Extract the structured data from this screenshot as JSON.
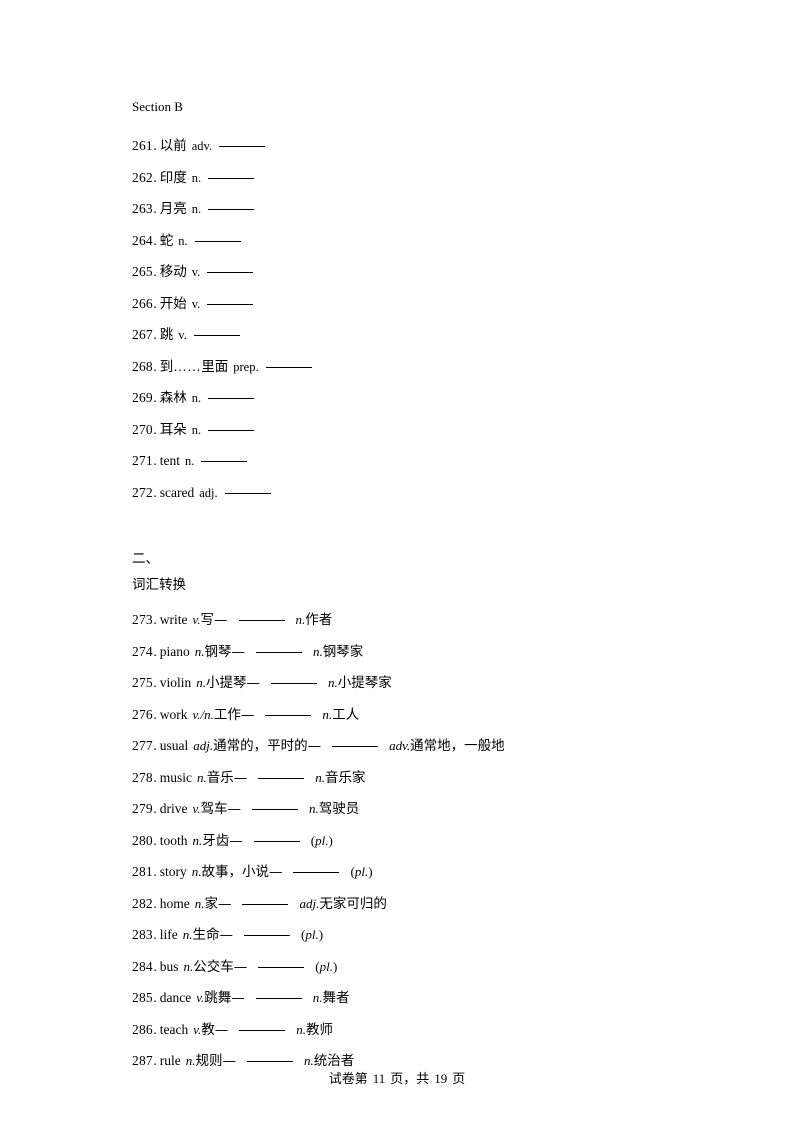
{
  "document": {
    "section_b_label": "Section B",
    "part_two_heading": "二、",
    "part_two_subheading": "词汇转换"
  },
  "vocab_items": [
    {
      "num": "261",
      "dot": ".",
      "term": "以前",
      "term_lang": "cn",
      "pos": "adv.",
      "pos_italic": false
    },
    {
      "num": "262",
      "dot": ".",
      "term": "印度",
      "term_lang": "cn",
      "pos": "n.",
      "pos_italic": false
    },
    {
      "num": "263",
      "dot": ".",
      "term": "月亮",
      "term_lang": "cn",
      "pos": "n.",
      "pos_italic": false
    },
    {
      "num": "264",
      "dot": ".",
      "term": "蛇",
      "term_lang": "cn",
      "pos": "n.",
      "pos_italic": false
    },
    {
      "num": "265",
      "dot": ".",
      "term": "移动",
      "term_lang": "cn",
      "pos": "v.",
      "pos_italic": false
    },
    {
      "num": "266",
      "dot": ".",
      "term": "开始",
      "term_lang": "cn",
      "pos": "v.",
      "pos_italic": false
    },
    {
      "num": "267",
      "dot": ".",
      "term": "跳",
      "term_lang": "cn",
      "pos": "v.",
      "pos_italic": false
    },
    {
      "num": "268",
      "dot": ".",
      "term": "到……里面",
      "term_lang": "cn",
      "pos": "prep.",
      "pos_italic": false
    },
    {
      "num": "269",
      "dot": ".",
      "term": "森林",
      "term_lang": "cn",
      "pos": "n.",
      "pos_italic": false
    },
    {
      "num": "270",
      "dot": ".",
      "term": "耳朵",
      "term_lang": "cn",
      "pos": "n.",
      "pos_italic": false
    },
    {
      "num": "271",
      "dot": ".",
      "term": "tent",
      "term_lang": "en",
      "pos": "n.",
      "pos_italic": false
    },
    {
      "num": "272",
      "dot": ".",
      "term": "scared",
      "term_lang": "en",
      "pos": "adj.",
      "pos_italic": false
    }
  ],
  "conversion_items": [
    {
      "num": "273",
      "dot": ".",
      "word": "write",
      "pos1": "v.",
      "gloss1": "写",
      "answer_pos": "n.",
      "answer_gloss": "作者"
    },
    {
      "num": "274",
      "dot": ".",
      "word": "piano",
      "pos1": "n.",
      "gloss1": "钢琴",
      "answer_pos": "n.",
      "answer_gloss": "钢琴家"
    },
    {
      "num": "275",
      "dot": ".",
      "word": "violin",
      "pos1": "n.",
      "gloss1": "小提琴",
      "answer_pos": "n.",
      "answer_gloss": "小提琴家"
    },
    {
      "num": "276",
      "dot": ".",
      "word": "work",
      "pos1": "v./n.",
      "gloss1": "工作",
      "answer_pos": "n.",
      "answer_gloss": "工人"
    },
    {
      "num": "277",
      "dot": ".",
      "word": "usual",
      "pos1": "adj.",
      "gloss1": "通常的，平时的",
      "answer_pos": "adv.",
      "answer_gloss": "通常地，一般地"
    },
    {
      "num": "278",
      "dot": ".",
      "word": "music",
      "pos1": "n.",
      "gloss1": "音乐",
      "answer_pos": "n.",
      "answer_gloss": "音乐家"
    },
    {
      "num": "279",
      "dot": ".",
      "word": "drive",
      "pos1": "v.",
      "gloss1": "驾车",
      "answer_pos": "n.",
      "answer_gloss": "驾驶员"
    },
    {
      "num": "280",
      "dot": ".",
      "word": "tooth",
      "pos1": "n.",
      "gloss1": "牙齿",
      "answer_pos": "",
      "answer_gloss": "",
      "plural": "pl."
    },
    {
      "num": "281",
      "dot": ".",
      "word": "story",
      "pos1": "n.",
      "gloss1": "故事，小说",
      "answer_pos": "",
      "answer_gloss": "",
      "plural": "pl."
    },
    {
      "num": "282",
      "dot": ".",
      "word": "home",
      "pos1": "n.",
      "gloss1": "家",
      "answer_pos": "adj.",
      "answer_gloss": "无家可归的"
    },
    {
      "num": "283",
      "dot": ".",
      "word": "life",
      "pos1": "n.",
      "gloss1": "生命",
      "answer_pos": "",
      "answer_gloss": "",
      "plural": "pl."
    },
    {
      "num": "284",
      "dot": ".",
      "word": "bus",
      "pos1": "n.",
      "gloss1": "公交车",
      "answer_pos": "",
      "answer_gloss": "",
      "plural": "pl."
    },
    {
      "num": "285",
      "dot": ".",
      "word": "dance",
      "pos1": "v.",
      "gloss1": "跳舞",
      "answer_pos": "n.",
      "answer_gloss": "舞者"
    },
    {
      "num": "286",
      "dot": ".",
      "word": "teach",
      "pos1": "v.",
      "gloss1": "教",
      "answer_pos": "n.",
      "answer_gloss": "教师"
    },
    {
      "num": "287",
      "dot": ".",
      "word": "rule",
      "pos1": "n.",
      "gloss1": "规则",
      "answer_pos": "n.",
      "answer_gloss": "统治者"
    }
  ],
  "symbols": {
    "dash": "—",
    "paren_open": "(",
    "paren_close": ")"
  },
  "footer": {
    "prefix": "试卷第",
    "page": "11",
    "middle": "页，共",
    "total": "19",
    "suffix": "页"
  }
}
